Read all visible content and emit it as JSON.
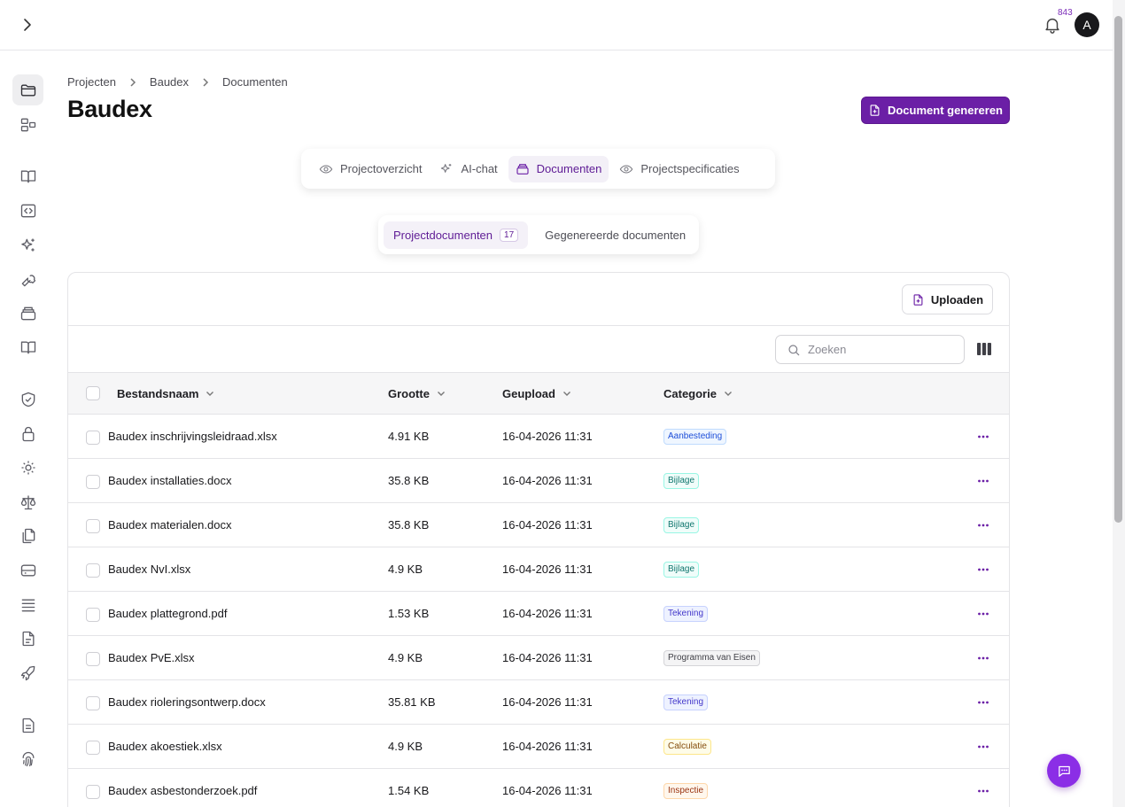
{
  "topbar": {
    "notification_count": "843",
    "avatar_initial": "A"
  },
  "breadcrumb": [
    "Projecten",
    "Baudex",
    "Documenten"
  ],
  "page_title": "Baudex",
  "generate_button": "Document genereren",
  "tabs": [
    {
      "label": "Projectoverzicht",
      "icon": "eye-icon"
    },
    {
      "label": "AI-chat",
      "icon": "sparkles-icon"
    },
    {
      "label": "Documenten",
      "icon": "archive-icon",
      "active": true
    },
    {
      "label": "Projectspecificaties",
      "icon": "eye-icon"
    }
  ],
  "subtabs": {
    "project_docs": "Projectdocumenten",
    "project_docs_count": "17",
    "generated_docs": "Gegenereerde documenten"
  },
  "upload_button": "Uploaden",
  "search": {
    "placeholder": "Zoeken",
    "value": ""
  },
  "table": {
    "columns": [
      "Bestandsnaam",
      "Grootte",
      "Geupload",
      "Categorie"
    ],
    "rows": [
      {
        "name": "Baudex inschrijvingsleidraad.xlsx",
        "size": "4.91 KB",
        "uploaded": "16-04-2026 11:31",
        "category": "Aanbesteding"
      },
      {
        "name": "Baudex installaties.docx",
        "size": "35.8 KB",
        "uploaded": "16-04-2026 11:31",
        "category": "Bijlage"
      },
      {
        "name": "Baudex materialen.docx",
        "size": "35.8 KB",
        "uploaded": "16-04-2026 11:31",
        "category": "Bijlage"
      },
      {
        "name": "Baudex NvI.xlsx",
        "size": "4.9 KB",
        "uploaded": "16-04-2026 11:31",
        "category": "Bijlage"
      },
      {
        "name": "Baudex plattegrond.pdf",
        "size": "1.53 KB",
        "uploaded": "16-04-2026 11:31",
        "category": "Tekening"
      },
      {
        "name": "Baudex PvE.xlsx",
        "size": "4.9 KB",
        "uploaded": "16-04-2026 11:31",
        "category": "Programma van Eisen"
      },
      {
        "name": "Baudex rioleringsontwerp.docx",
        "size": "35.81 KB",
        "uploaded": "16-04-2026 11:31",
        "category": "Tekening"
      },
      {
        "name": "Baudex akoestiek.xlsx",
        "size": "4.9 KB",
        "uploaded": "16-04-2026 11:31",
        "category": "Calculatie"
      },
      {
        "name": "Baudex asbestonderzoek.pdf",
        "size": "1.54 KB",
        "uploaded": "16-04-2026 11:31",
        "category": "Inspectie"
      }
    ]
  },
  "category_colors": {
    "Aanbesteding": {
      "text": "#1d4ed8",
      "bg": "#eff6ff",
      "border": "#bfdbfe"
    },
    "Bijlage": {
      "text": "#0f766e",
      "bg": "#f0fdfa",
      "border": "#99f6e4"
    },
    "Tekening": {
      "text": "#4338ca",
      "bg": "#eef2ff",
      "border": "#c7d2fe"
    },
    "Programma van Eisen": {
      "text": "#3f3f46",
      "bg": "#f4f4f5",
      "border": "#d4d4d8"
    },
    "Calculatie": {
      "text": "#854d0e",
      "bg": "#fefce8",
      "border": "#fde68a"
    },
    "Inspectie": {
      "text": "#9a3412",
      "bg": "#fff7ed",
      "border": "#fed7aa"
    }
  },
  "sidebar_icons": [
    "folder-icon",
    "layout-icon",
    "book-open-icon",
    "code-icon",
    "sparkles-icon",
    "wrench-icon",
    "archive-icon",
    "book-icon",
    "shield-check-icon",
    "lock-icon",
    "settings-icon",
    "scale-icon",
    "files-icon",
    "database-icon",
    "list-icon",
    "file-text-icon",
    "rocket-icon",
    "document-icon",
    "fingerprint-icon"
  ],
  "accent_color": "#6b1fa6"
}
